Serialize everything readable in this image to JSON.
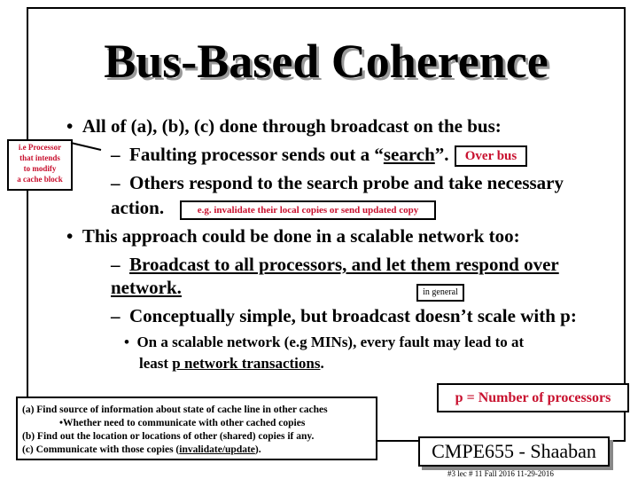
{
  "title": "Bus-Based Coherence",
  "bullets": [
    {
      "text": "All of (a), (b), (c) done through broadcast on the bus:",
      "subs": [
        {
          "pre": "Faulting processor sends out a “",
          "u": "search",
          "post": "”."
        },
        {
          "line1": "Others respond to the search probe and take necessary",
          "line2": "action."
        }
      ]
    },
    {
      "text": "This approach could be done in a scalable network too:",
      "subs": [
        {
          "line1": "Broadcast to all processors, and let them respond over",
          "line2": "network."
        },
        {
          "line1": "Conceptually simple, but broadcast doesn’t scale with p:"
        }
      ],
      "subsub": {
        "line1": "On a scalable network (e.g MINs), every fault may lead to at",
        "line2_pre": "least  ",
        "line2_u": "p network transactions",
        "line2_post": "."
      }
    }
  ],
  "annotations": {
    "side_note": [
      "i.e Processor",
      "that intends",
      "to modify",
      "a cache block"
    ],
    "over_bus": "Over bus",
    "action_note": "e.g. invalidate their local copies or send updated copy",
    "in_general": "in general",
    "p_def": "p = Number of processors"
  },
  "steps": {
    "a": "(a)  Find source of information about state of cache line in other caches",
    "a_sub": "•Whether need to communicate with other cached copies",
    "b": "(b)  Find out the location or locations of other (shared) copies if any.",
    "c_pre": "(c)  Communicate with those copies  (",
    "c_u": "invalidate/update",
    "c_post": ")."
  },
  "footer": {
    "brand": "CMPE655 - Shaaban",
    "meta": "#3   lec # 11   Fall 2016   11-29-2016"
  },
  "colors": {
    "accent_red": "#c8102e"
  }
}
